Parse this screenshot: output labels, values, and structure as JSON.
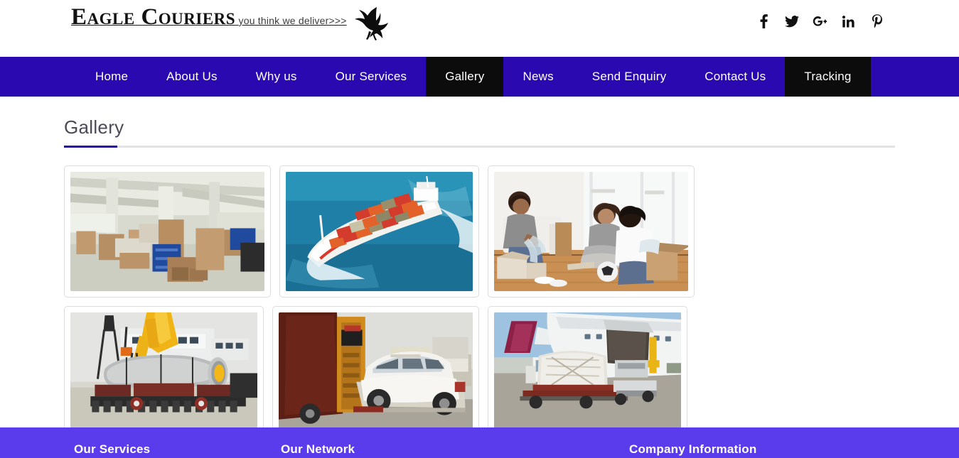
{
  "site": {
    "logo_main": "Eagle Couriers",
    "logo_tagline": "you think we deliver>>>",
    "logo_bird_icon": "eagle-icon"
  },
  "social": [
    {
      "name": "facebook-icon",
      "glyph": "f",
      "label": "Facebook"
    },
    {
      "name": "twitter-icon",
      "glyph": "",
      "label": "Twitter"
    },
    {
      "name": "google-plus-icon",
      "glyph": "G+",
      "label": "Google Plus"
    },
    {
      "name": "linkedin-icon",
      "glyph": "in",
      "label": "LinkedIn"
    },
    {
      "name": "pinterest-icon",
      "glyph": "P",
      "label": "Pinterest"
    }
  ],
  "nav": {
    "items": [
      {
        "label": "Home",
        "state": "normal"
      },
      {
        "label": "About Us",
        "state": "normal"
      },
      {
        "label": "Why us",
        "state": "normal"
      },
      {
        "label": "Our Services",
        "state": "normal"
      },
      {
        "label": "Gallery",
        "state": "active"
      },
      {
        "label": "News",
        "state": "normal"
      },
      {
        "label": "Send Enquiry",
        "state": "normal"
      },
      {
        "label": "Contact Us",
        "state": "normal"
      },
      {
        "label": "Tracking",
        "state": "highlight"
      }
    ]
  },
  "page": {
    "title": "Gallery"
  },
  "gallery": {
    "items": [
      {
        "name": "gallery-thumb-warehouse",
        "alt": "Warehouse floor stacked with wrapped cargo pallets and blue crates"
      },
      {
        "name": "gallery-thumb-container-ship",
        "alt": "Container ship loaded with red and orange containers at sea"
      },
      {
        "name": "gallery-thumb-family-packing",
        "alt": "Family packing household goods into moving boxes"
      },
      {
        "name": "gallery-thumb-heavy-lift",
        "alt": "Crane lifting a large pressure vessel onto a multi-axle trailer at port"
      },
      {
        "name": "gallery-thumb-car-loading",
        "alt": "White SUV being loaded into a shipping container truck"
      },
      {
        "name": "gallery-thumb-air-cargo",
        "alt": "Wrapped air cargo pallet on a loader beside an aircraft"
      }
    ]
  },
  "footer": {
    "columns": [
      {
        "heading": "Our Services"
      },
      {
        "heading": "Our Network"
      },
      {
        "heading": "Company Information"
      }
    ]
  },
  "colors": {
    "nav_bg": "#2a09b0",
    "nav_active_bg": "#0c0c0c",
    "footer_bg": "#5b3cec",
    "accent": "#2a09b0",
    "title_text": "#4b4b58",
    "rule": "#e3e3e3",
    "card_border": "#dddddd"
  }
}
